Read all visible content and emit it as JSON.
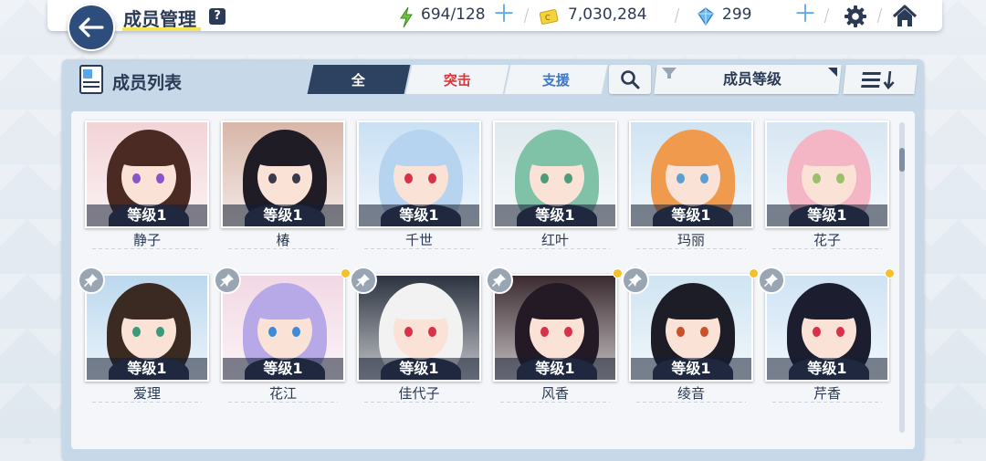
{
  "header": {
    "title": "成员管理",
    "help": "?",
    "stamina": "694/128",
    "credits": "7,030,284",
    "gems": "299"
  },
  "panel": {
    "title": "成员列表",
    "filters": [
      "全",
      "突击",
      "支援"
    ],
    "active_filter": "全",
    "sort_label": "成员等级"
  },
  "members": [
    {
      "name": "静子",
      "level": "等级1",
      "pinned": false,
      "new": false,
      "bg": "#f2d3d6",
      "hair": "#4a2a22",
      "eye": "#8a55c8"
    },
    {
      "name": "椿",
      "level": "等级1",
      "pinned": false,
      "new": false,
      "bg": "#d7b6a8",
      "hair": "#1f1c26",
      "eye": "#3a3a4a"
    },
    {
      "name": "千世",
      "level": "等级1",
      "pinned": false,
      "new": false,
      "bg": "#c9e0f4",
      "hair": "#b6d4f0",
      "eye": "#d8324a"
    },
    {
      "name": "红叶",
      "level": "等级1",
      "pinned": false,
      "new": false,
      "bg": "#dfe9ee",
      "hair": "#7fc2a8",
      "eye": "#4e9c7a"
    },
    {
      "name": "玛丽",
      "level": "等级1",
      "pinned": false,
      "new": false,
      "bg": "#cfe3f2",
      "hair": "#f09a4e",
      "eye": "#5aa0d0"
    },
    {
      "name": "花子",
      "level": "等级1",
      "pinned": false,
      "new": false,
      "bg": "#d7e6f2",
      "hair": "#f4b6c4",
      "eye": "#9ac06a"
    },
    {
      "name": "爱理",
      "level": "等级1",
      "pinned": true,
      "new": false,
      "bg": "#bcd8ee",
      "hair": "#3b2a22",
      "eye": "#3a9a7a"
    },
    {
      "name": "花江",
      "level": "等级1",
      "pinned": true,
      "new": true,
      "bg": "#f2d8e4",
      "hair": "#b7a8e8",
      "eye": "#3c8ad8"
    },
    {
      "name": "佳代子",
      "level": "等级1",
      "pinned": true,
      "new": false,
      "bg": "#2c3340",
      "hair": "#f2f2f2",
      "eye": "#d8324a"
    },
    {
      "name": "风香",
      "level": "等级1",
      "pinned": true,
      "new": true,
      "bg": "#3a2a30",
      "hair": "#231a26",
      "eye": "#d8324a"
    },
    {
      "name": "绫音",
      "level": "等级1",
      "pinned": true,
      "new": true,
      "bg": "#cfe4f2",
      "hair": "#1d1d28",
      "eye": "#c8502a"
    },
    {
      "name": "芹香",
      "level": "等级1",
      "pinned": true,
      "new": true,
      "bg": "#cfe3f4",
      "hair": "#1c1e30",
      "eye": "#d8324a"
    }
  ],
  "colors": {
    "accent": "#2d4160",
    "attack": "#d8383a",
    "support": "#3a78c8",
    "new_dot": "#f6c02b"
  }
}
